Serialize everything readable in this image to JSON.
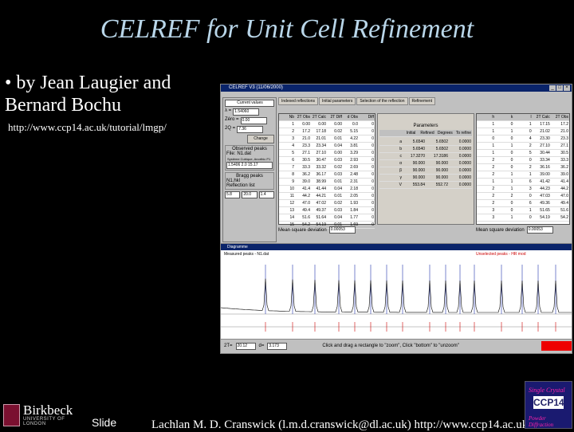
{
  "slide": {
    "title": "CELREF for Unit Cell Refinement",
    "bullet": "• by Jean Laugier and Bernard Bochu",
    "url": "http://www.ccp14.ac.uk/tutorial/lmgp/",
    "slide_label": "Slide",
    "footer": "Lachlan M. D. Cranswick (l.m.d.cranswick@dl.ac.uk) http://www.ccp14.ac.uk",
    "logo_left": {
      "name": "Birkbeck",
      "sub": "UNIVERSITY OF LONDON"
    },
    "logo_right": {
      "line1": "Single Crystal",
      "line2": "CCP14",
      "line3": "Powder Diffraction"
    }
  },
  "app": {
    "title": "CELREF V3 (11/06/2000)",
    "tabs": [
      "Indexed reflections",
      "Initial parameters",
      "Selection of the reflection",
      "Refinement"
    ],
    "left_panel": {
      "header": "Current values",
      "lambda_label": "λ =",
      "lambda": "1.54060",
      "zero_label": "Zéro =",
      "zero": "0.00",
      "twoq_label": "2Q =",
      "twoq": "7.36",
      "change_btn": "Change",
      "observed_label": "Observed peaks",
      "file_label": "File:",
      "file": "N1.dat",
      "system_label": "Système Cubique, Anorthic P1",
      "dataset_label": "1.5406  2.0  15.17",
      "bragg_label": "Bragg peaks",
      "hkl_file": "N1.hkl",
      "group_label": "Reflection list",
      "foot_values": [
        "5.8",
        "20.0",
        "1.4"
      ]
    },
    "refine_table": {
      "header": "Refinement",
      "cols": [
        "Nb",
        "2T Obs",
        "2T Calc",
        "2T Diff",
        "d Obs",
        "Diff"
      ],
      "rows": [
        [
          "1",
          "0.00",
          "0.00",
          "0.00",
          "0.0",
          "0"
        ],
        [
          "2",
          "17.2",
          "17.18",
          "0.02",
          "5.15",
          "0"
        ],
        [
          "3",
          "21.0",
          "21.01",
          "0.01",
          "4.22",
          "0"
        ],
        [
          "4",
          "23.3",
          "23.34",
          "0.04",
          "3.81",
          "0"
        ],
        [
          "5",
          "27.1",
          "27.10",
          "0.00",
          "3.29",
          "0"
        ],
        [
          "6",
          "30.5",
          "30.47",
          "0.03",
          "2.93",
          "0"
        ],
        [
          "7",
          "33.3",
          "33.32",
          "0.02",
          "2.69",
          "0"
        ],
        [
          "8",
          "36.2",
          "36.17",
          "0.03",
          "2.48",
          "0"
        ],
        [
          "9",
          "39.0",
          "38.99",
          "0.01",
          "2.31",
          "0"
        ],
        [
          "10",
          "41.4",
          "41.44",
          "0.04",
          "2.18",
          "0"
        ],
        [
          "11",
          "44.2",
          "44.21",
          "0.01",
          "2.05",
          "0"
        ],
        [
          "12",
          "47.0",
          "47.02",
          "0.02",
          "1.93",
          "0"
        ],
        [
          "13",
          "49.4",
          "49.37",
          "0.03",
          "1.84",
          "0"
        ],
        [
          "14",
          "51.6",
          "51.64",
          "0.04",
          "1.77",
          "0"
        ],
        [
          "15",
          "54.2",
          "54.19",
          "0.01",
          "1.69",
          "0"
        ]
      ]
    },
    "param_panel": {
      "header": "Parameters",
      "cols": [
        "Initial",
        "Refined",
        "Degrees",
        "To refine"
      ],
      "rows": [
        [
          "a",
          "5.6540",
          "5.6502",
          "0.0000"
        ],
        [
          "b",
          "5.6540",
          "5.6502",
          "0.0000"
        ],
        [
          "c",
          "17.3270",
          "17.3186",
          "0.0000"
        ],
        [
          "α",
          "90.000",
          "90.000",
          "0.0000"
        ],
        [
          "β",
          "90.000",
          "90.000",
          "0.0000"
        ],
        [
          "γ",
          "90.000",
          "90.000",
          "0.0000"
        ],
        [
          "V",
          "553.84",
          "552.72",
          "0.0000"
        ]
      ]
    },
    "after_table": {
      "header": "After refinement",
      "cols": [
        "h",
        "k",
        "l",
        "2T Calc",
        "2T Obs"
      ],
      "rows": [
        [
          "1",
          "0",
          "1",
          "17.15",
          "17.2"
        ],
        [
          "1",
          "1",
          "0",
          "21.02",
          "21.0"
        ],
        [
          "0",
          "0",
          "4",
          "23.30",
          "23.3"
        ],
        [
          "1",
          "1",
          "2",
          "27.10",
          "27.1"
        ],
        [
          "1",
          "0",
          "5",
          "30.44",
          "30.5"
        ],
        [
          "2",
          "0",
          "0",
          "33.34",
          "33.3"
        ],
        [
          "2",
          "0",
          "2",
          "36.16",
          "36.2"
        ],
        [
          "2",
          "1",
          "1",
          "39.00",
          "39.0"
        ],
        [
          "1",
          "1",
          "6",
          "41.42",
          "41.4"
        ],
        [
          "2",
          "1",
          "3",
          "44.23",
          "44.2"
        ],
        [
          "2",
          "2",
          "0",
          "47.03",
          "47.0"
        ],
        [
          "2",
          "0",
          "6",
          "49.36",
          "49.4"
        ],
        [
          "3",
          "0",
          "1",
          "51.65",
          "51.6"
        ],
        [
          "3",
          "1",
          "0",
          "54.19",
          "54.2"
        ]
      ]
    },
    "mean_square_label": "Mean square deviation",
    "mean_square_value": "0.00053",
    "pattern": {
      "title": "Diagramme",
      "subtitle": "Measured peaks - N1.dat",
      "markers_label": "Unselected peaks - HR mod",
      "status_text": "Click and drag a rectangle to \"zoom\", Click \"bottom\" to \"unzoom\"",
      "twotheta_label": "2T=",
      "twotheta_value": "20.12",
      "d_label": "d=",
      "d_value": "3.173"
    }
  }
}
